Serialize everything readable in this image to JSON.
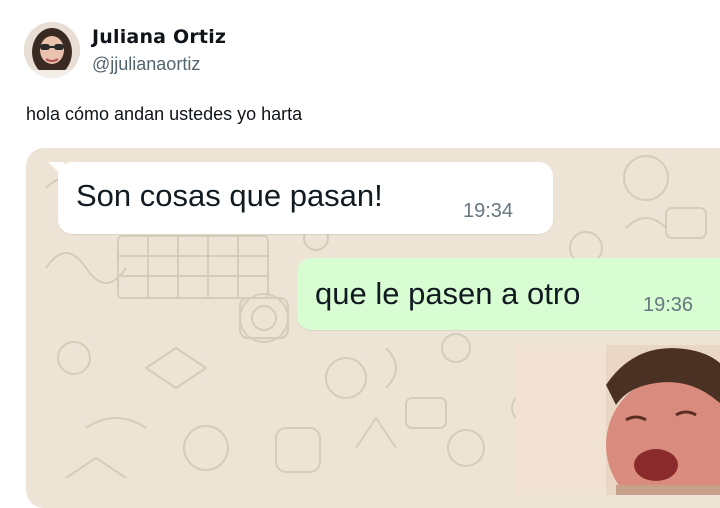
{
  "tweet": {
    "display_name": "Juliana Ortiz",
    "handle": "@jjulianaortiz",
    "text": "hola cómo andan ustedes yo harta"
  },
  "chat": {
    "incoming": {
      "text": "Son cosas que pasan!",
      "time": "19:34"
    },
    "outgoing": {
      "text": "que le pasen a otro",
      "time": "19:36"
    },
    "photo": {
      "subject": "crying-child-photo"
    }
  },
  "colors": {
    "chat_background": "#ede4d6",
    "incoming_bubble": "#ffffff",
    "outgoing_bubble": "#d9fdd3",
    "timestamp": "#667781",
    "handle": "#536471",
    "text": "#0f1419"
  }
}
